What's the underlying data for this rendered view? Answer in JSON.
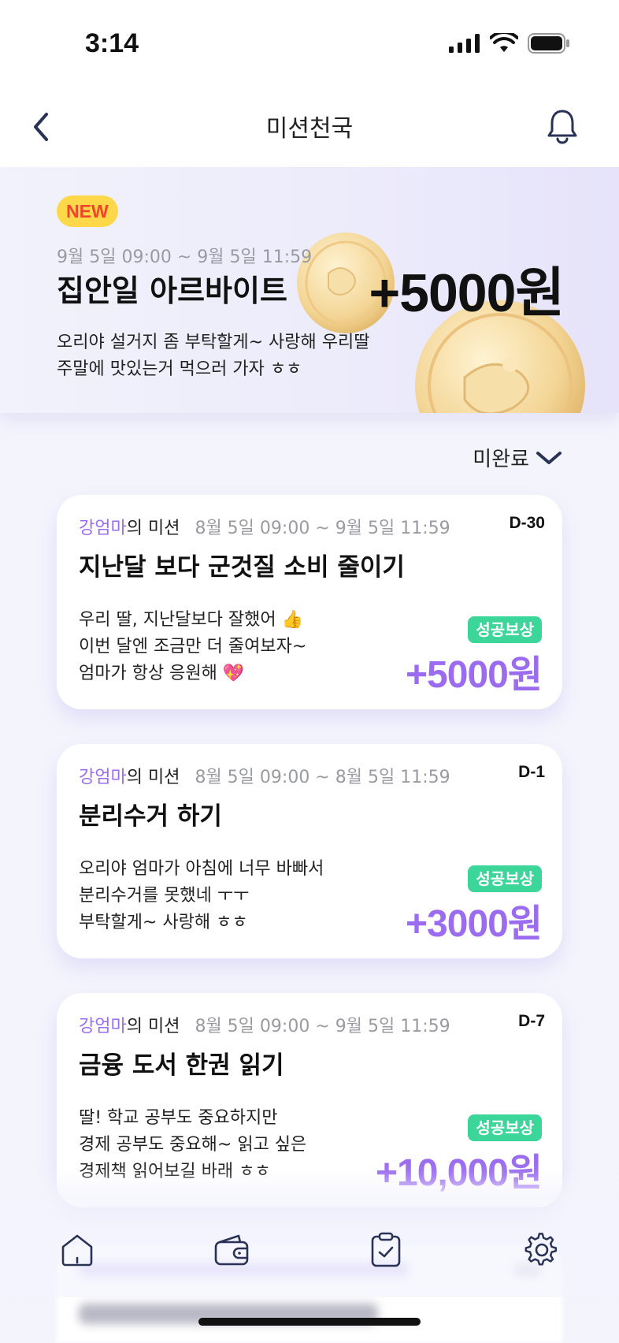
{
  "status_bar": {
    "time": "3:14"
  },
  "nav": {
    "title": "미션천국"
  },
  "banner": {
    "badge": "NEW",
    "date": "9월 5일 09:00 ~ 9월 5일 11:59",
    "title": "집안일 아르바이트",
    "amount": "+5000원",
    "description": [
      "오리야 설거지 좀 부탁할게~ 사랑해 우리딸",
      "주말에 맛있는거 먹으러 가자 ㅎㅎ"
    ]
  },
  "filter": {
    "label": "미완료"
  },
  "missions": [
    {
      "owner": "강엄마",
      "owner_suffix": "의 미션",
      "date": "8월 5일 09:00 ~ 9월 5일 11:59",
      "dday": "D-30",
      "title": "지난달 보다 군것질 소비 줄이기",
      "description": [
        "우리 딸, 지난달보다 잘했어 👍",
        "이번 달엔 조금만 더 줄여보자~",
        "엄마가 항상 응원해 💖"
      ],
      "reward_label": "성공보상",
      "reward": "+5000원"
    },
    {
      "owner": "강엄마",
      "owner_suffix": "의 미션",
      "date": "8월 5일 09:00 ~ 8월 5일 11:59",
      "dday": "D-1",
      "title": "분리수거 하기",
      "description": [
        "오리야 엄마가 아침에 너무 바빠서",
        "분리수거를 못했네 ㅜㅜ",
        "부탁할게~ 사랑해 ㅎㅎ"
      ],
      "reward_label": "성공보상",
      "reward": "+3000원"
    },
    {
      "owner": "강엄마",
      "owner_suffix": "의 미션",
      "date": "8월 5일 09:00 ~ 9월 5일 11:59",
      "dday": "D-7",
      "title": "금융 도서 한권 읽기",
      "description": [
        "딸! 학교 공부도 중요하지만",
        "경제 공부도 중요해~ 읽고 싶은",
        "경제책 읽어보길 바래 ㅎㅎ"
      ],
      "reward_label": "성공보상",
      "reward": "+10,000원"
    }
  ],
  "tabs": [
    {
      "icon": "home-icon"
    },
    {
      "icon": "wallet-icon"
    },
    {
      "icon": "clipboard-check-icon"
    },
    {
      "icon": "settings-gear-icon"
    }
  ],
  "colors": {
    "accent_purple": "#9b6cf0",
    "reward_green": "#3cd59a",
    "new_badge_yellow": "#ffd84a",
    "new_badge_red": "#f0452b",
    "navy_icon": "#2a3356"
  }
}
